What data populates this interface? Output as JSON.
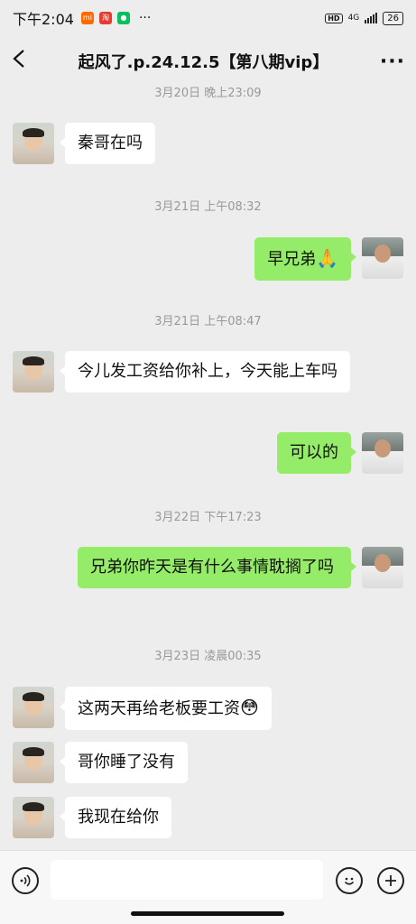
{
  "status": {
    "time": "下午2:04",
    "network": "4G",
    "battery": "26",
    "more": "···"
  },
  "header": {
    "back_icon": "chevron-left",
    "title": "起风了.p.24.12.5【第八期vip】",
    "more_icon": "···"
  },
  "timestamps": [
    "3月20日 晚上23:09",
    "3月21日 上午08:32",
    "3月21日 上午08:47",
    "3月22日 下午17:23",
    "3月23日 凌晨00:35"
  ],
  "messages": [
    {
      "side": "in",
      "text": "秦哥在吗"
    },
    {
      "side": "out",
      "text": "早兄弟",
      "emoji": "🙏"
    },
    {
      "side": "in",
      "text": "今儿发工资给你补上，今天能上车吗"
    },
    {
      "side": "out",
      "text": "可以的"
    },
    {
      "side": "out",
      "text": "兄弟你昨天是有什么事情耽搁了吗"
    },
    {
      "side": "in",
      "text": "这两天再给老板要工资",
      "emoji": "😳"
    },
    {
      "side": "in",
      "text": "哥你睡了没有"
    },
    {
      "side": "in",
      "text": "我现在给你"
    }
  ],
  "input": {
    "value": "",
    "voice_icon": "voice-icon",
    "emoji_icon": "emoji-icon",
    "plus_icon": "plus-icon"
  },
  "colors": {
    "bg": "#ededed",
    "outgoing": "#95ec69",
    "incoming": "#ffffff"
  }
}
